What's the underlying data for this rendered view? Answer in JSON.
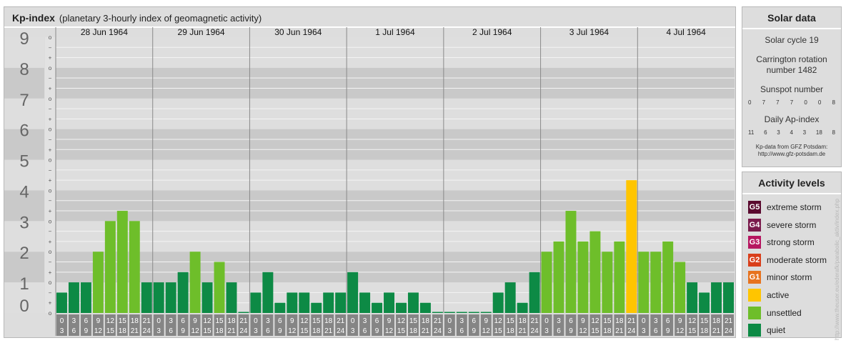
{
  "header": {
    "title": "Kp-index",
    "subtitle": "(planetary 3-hourly index of geomagnetic activity)"
  },
  "chart_data": {
    "type": "bar",
    "title": "Kp-index",
    "subtitle": "(planetary 3-hourly index of geomagnetic activity)",
    "ylim": [
      0,
      9
    ],
    "y_ticks": [
      "0",
      "1",
      "2",
      "3",
      "4",
      "5",
      "6",
      "7",
      "8",
      "9"
    ],
    "minor_ticks": [
      "o",
      "+",
      "−"
    ],
    "days": [
      "28 Jun 1964",
      "29 Jun 1964",
      "30 Jun 1964",
      "1 Jul 1964",
      "2 Jul 1964",
      "3 Jul 1964",
      "4 Jul 1964"
    ],
    "interval_labels": [
      [
        "0",
        "3"
      ],
      [
        "3",
        "6"
      ],
      [
        "6",
        "9"
      ],
      [
        "9",
        "12"
      ],
      [
        "12",
        "15"
      ],
      [
        "15",
        "18"
      ],
      [
        "18",
        "21"
      ],
      [
        "21",
        "24"
      ]
    ],
    "values": [
      [
        0.667,
        1.0,
        1.0,
        2.0,
        3.0,
        3.333,
        3.0,
        1.0
      ],
      [
        1.0,
        1.0,
        1.333,
        2.0,
        1.0,
        1.667,
        1.0,
        0.0
      ],
      [
        0.667,
        1.333,
        0.333,
        0.667,
        0.667,
        0.333,
        0.667,
        0.667
      ],
      [
        1.333,
        0.667,
        0.333,
        0.667,
        0.333,
        0.667,
        0.333,
        0.0
      ],
      [
        0.0,
        0.0,
        0.0,
        0.0,
        0.667,
        1.0,
        0.333,
        1.333
      ],
      [
        2.0,
        2.333,
        3.333,
        2.333,
        2.667,
        2.0,
        2.333,
        4.333
      ],
      [
        2.0,
        2.0,
        2.333,
        1.667,
        1.0,
        0.667,
        1.0,
        1.0
      ]
    ],
    "level_colors": {
      "quiet": "#0d8a45",
      "unsettled": "#6ebe2a",
      "active": "#ffc500"
    },
    "grid": true
  },
  "solar": {
    "title": "Solar data",
    "cycle": "Solar cycle 19",
    "carrington_line1": "Carrington rotation",
    "carrington_line2": "number 1482",
    "sunspot_label": "Sunspot number",
    "sunspot_values": [
      "0",
      "7",
      "7",
      "7",
      "0",
      "0",
      "8"
    ],
    "ap_label": "Daily Ap-index",
    "ap_values": [
      "11",
      "6",
      "3",
      "4",
      "3",
      "18",
      "8"
    ],
    "credit1": "Kp-data from GFZ Potsdam:",
    "credit2": "http://www.gfz-potsdam.de"
  },
  "activity": {
    "title": "Activity levels",
    "items": [
      {
        "code": "G5",
        "label": "extreme storm",
        "color": "#5a0a2f"
      },
      {
        "code": "G4",
        "label": "severe storm",
        "color": "#7a1b4c"
      },
      {
        "code": "G3",
        "label": "strong storm",
        "color": "#b61660"
      },
      {
        "code": "G2",
        "label": "moderate storm",
        "color": "#d93f1b"
      },
      {
        "code": "G1",
        "label": "minor storm",
        "color": "#e7731f"
      },
      {
        "code": "",
        "label": "active",
        "color": "#ffc500"
      },
      {
        "code": "",
        "label": "unsettled",
        "color": "#6ebe2a"
      },
      {
        "code": "",
        "label": "quiet",
        "color": "#0d8a45"
      }
    ]
  },
  "watermark": "http://www.theuser.eu/ederafk/parabolic_aktiv/index.php"
}
